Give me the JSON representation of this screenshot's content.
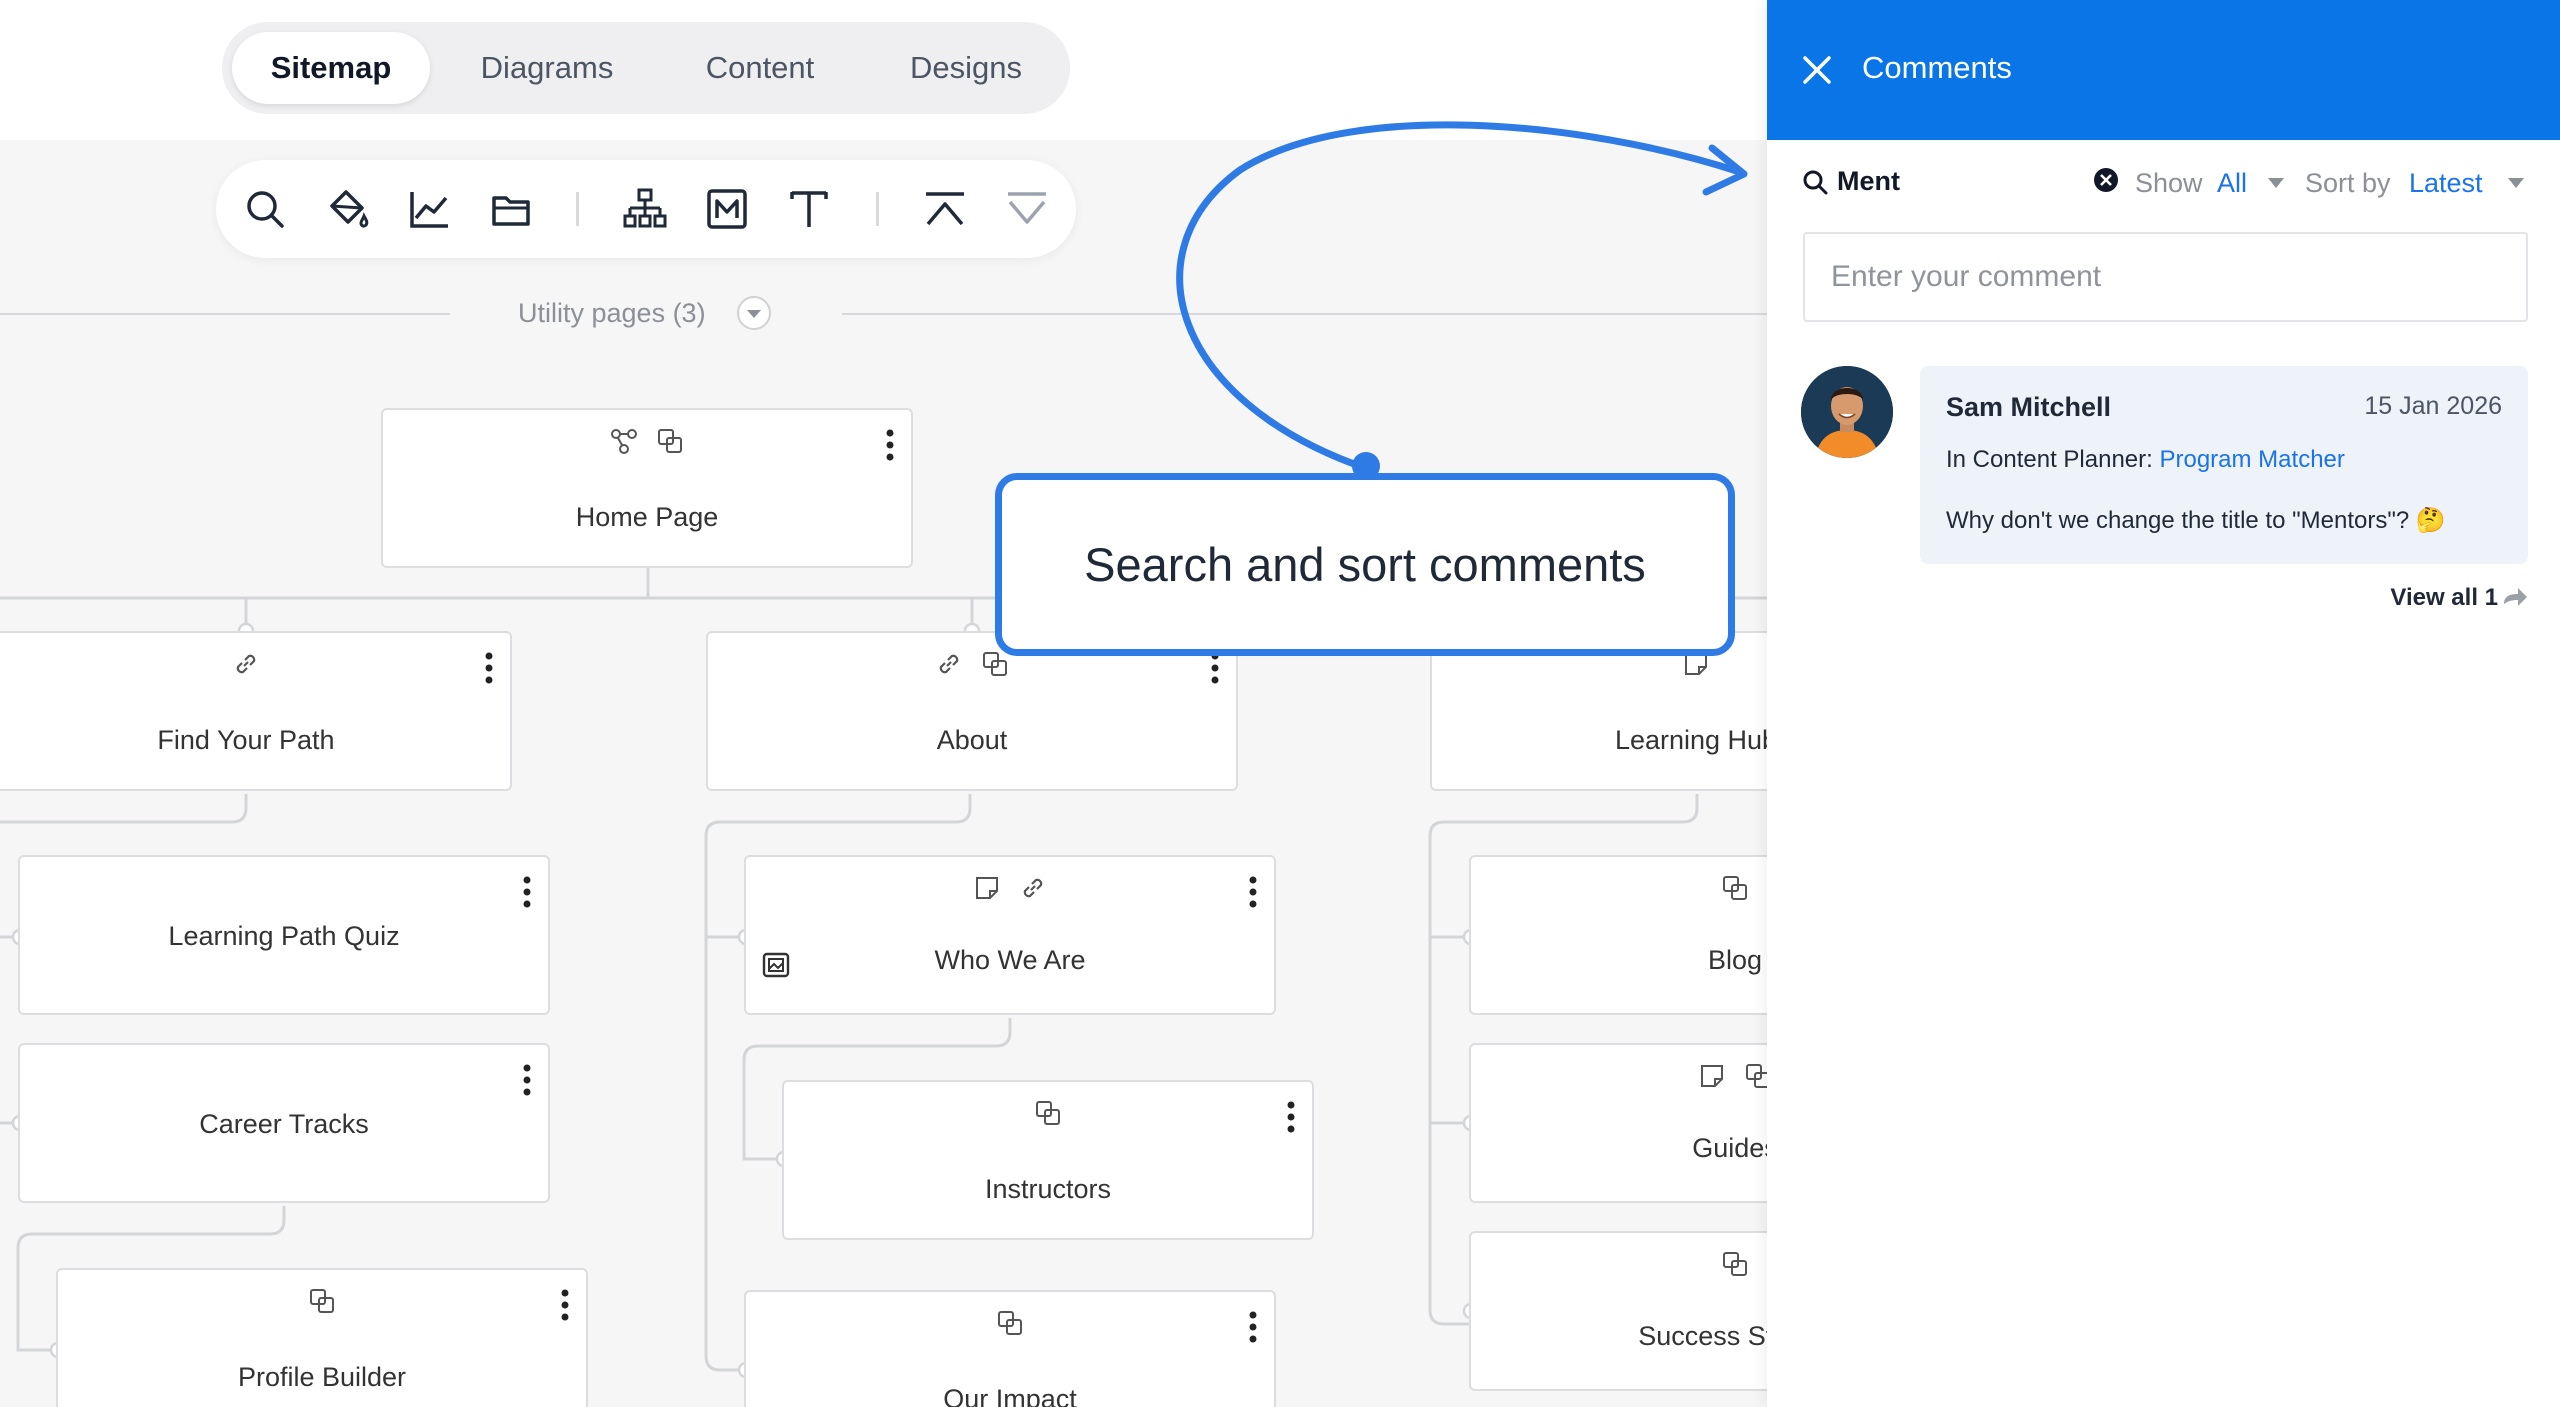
{
  "tabs": [
    {
      "label": "Sitemap",
      "active": true
    },
    {
      "label": "Diagrams",
      "active": false
    },
    {
      "label": "Content",
      "active": false
    },
    {
      "label": "Designs",
      "active": false
    }
  ],
  "toolbar": {
    "tools": [
      "search-icon",
      "paint-bucket-icon",
      "line-chart-icon",
      "folder-icon",
      "sitemap-icon",
      "markdown-icon",
      "text-icon",
      "collapse-up-icon",
      "expand-down-icon"
    ]
  },
  "utility": {
    "label": "Utility pages (3)"
  },
  "nodes": {
    "home": {
      "label": "Home Page"
    },
    "find_path": {
      "label": "Find Your Path"
    },
    "about": {
      "label": "About"
    },
    "learning_hub": {
      "label": "Learning Hub"
    },
    "quiz": {
      "label": "Learning Path Quiz"
    },
    "career": {
      "label": "Career Tracks"
    },
    "profile": {
      "label": "Profile Builder"
    },
    "who": {
      "label": "Who We Are"
    },
    "instructors": {
      "label": "Instructors"
    },
    "impact": {
      "label": "Our Impact"
    },
    "blog": {
      "label": "Blog"
    },
    "guides": {
      "label": "Guides"
    },
    "success": {
      "label": "Success Stories"
    }
  },
  "callout": {
    "text": "Search and sort comments"
  },
  "panel": {
    "title": "Comments",
    "search_term": "Ment",
    "show_label": "Show",
    "show_value": "All",
    "sort_label": "Sort by",
    "sort_value": "Latest",
    "input_placeholder": "Enter your comment",
    "comment": {
      "author": "Sam Mitchell",
      "date": "15 Jan 2026",
      "context_prefix": "In Content Planner:",
      "context_link": "Program Matcher",
      "body": "Why don't we change the title to \"Mentors\"? 🤔"
    },
    "view_all": "View all 1"
  },
  "colors": {
    "accent": "#0a75e6",
    "link": "#1a73e8",
    "callout_border": "#2f7be6"
  }
}
